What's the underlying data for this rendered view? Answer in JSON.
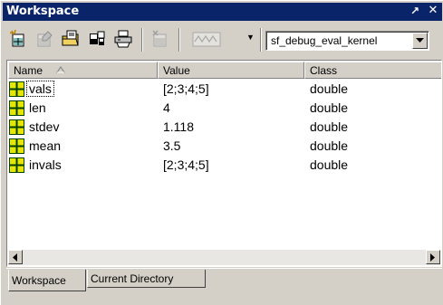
{
  "window": {
    "title": "Workspace",
    "undock_glyph": "↗",
    "close_glyph": "✕"
  },
  "toolbar": {
    "buttons": [
      {
        "icon": "new-variable-icon",
        "enabled": true
      },
      {
        "icon": "open-variable-icon",
        "enabled": false
      },
      {
        "icon": "load-data-icon",
        "enabled": true
      },
      {
        "icon": "save-workspace-icon",
        "enabled": true
      },
      {
        "icon": "print-icon",
        "enabled": true
      },
      {
        "icon": "delete-icon",
        "enabled": false
      },
      {
        "icon": "plot-icon",
        "enabled": false
      }
    ],
    "stack": {
      "selected": "sf_debug_eval_kernel"
    }
  },
  "table": {
    "columns": [
      {
        "label": "Name",
        "sort": "ascending"
      },
      {
        "label": "Value"
      },
      {
        "label": "Class"
      }
    ],
    "rows": [
      {
        "name": "vals",
        "value": "[2;3;4;5]",
        "class": "double",
        "focused": true
      },
      {
        "name": "len",
        "value": "4",
        "class": "double"
      },
      {
        "name": "stdev",
        "value": "1.118",
        "class": "double"
      },
      {
        "name": "mean",
        "value": "3.5",
        "class": "double"
      },
      {
        "name": "invals",
        "value": "[2;3;4;5]",
        "class": "double"
      }
    ]
  },
  "tabs": [
    {
      "label": "Workspace",
      "active": true
    },
    {
      "label": "Current Directory",
      "active": false
    }
  ],
  "colors": {
    "title_bar": "#0a246a",
    "chrome": "#d4d0c8",
    "variable_icon": "#e6e600"
  }
}
